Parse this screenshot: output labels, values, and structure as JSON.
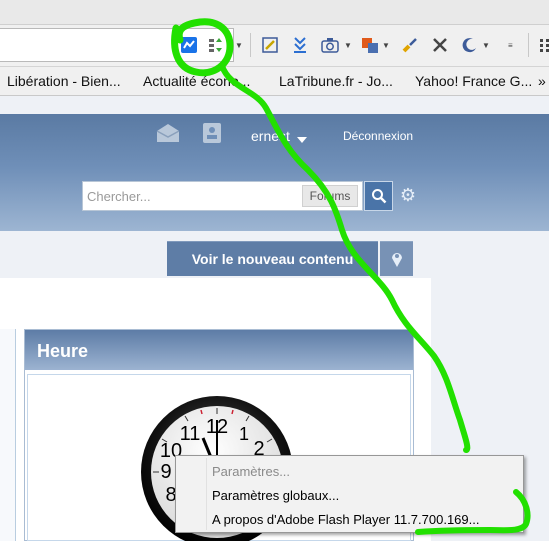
{
  "bookmarks": [
    {
      "label": "Libération - Bien..."
    },
    {
      "label": "Actualité écono..."
    },
    {
      "label": "LaTribune.fr - Jo..."
    },
    {
      "label": "Yahoo! France G..."
    }
  ],
  "bookmarks_more": "»",
  "forum": {
    "username": "ernest",
    "logout": "Déconnexion",
    "search_placeholder": "Chercher...",
    "search_scope": "Forums",
    "new_content": "Voir le nouveau contenu"
  },
  "widget": {
    "title": "Heure"
  },
  "clock": {
    "visible_numbers": [
      "11",
      "12",
      "1",
      "10",
      "2",
      "9",
      "8"
    ]
  },
  "context_menu": {
    "items": [
      {
        "label": "Paramètres...",
        "enabled": false
      },
      {
        "label": "Paramètres globaux...",
        "enabled": true
      },
      {
        "label": "A propos d'Adobe Flash Player 11.7.700.169...",
        "enabled": true
      }
    ]
  },
  "colors": {
    "header_top": "#5a7aa3",
    "header_bottom": "#9db5d2",
    "annotation": "#22e000",
    "toolbar_highlight": "#1a73e8"
  }
}
